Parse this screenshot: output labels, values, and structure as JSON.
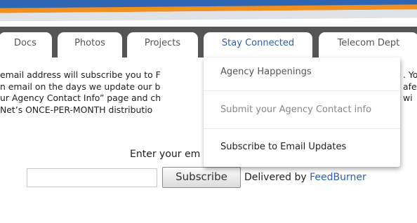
{
  "nav": {
    "tabs": [
      {
        "label": "Docs"
      },
      {
        "label": "Photos"
      },
      {
        "label": "Projects"
      },
      {
        "label": "Stay Connected"
      },
      {
        "label": "Telecom Dept"
      }
    ],
    "active_tab": "Stay Connected",
    "accent": "#2f5fa7",
    "bar_color": "#555555"
  },
  "dropdown": {
    "items": [
      {
        "label": "Agency Happenings"
      },
      {
        "label": "Submit your Agency Contact info"
      },
      {
        "label": "Subscribe to Email Updates"
      }
    ]
  },
  "content": {
    "lines": [
      "email address will subscribe you to F",
      "n email on the days we update our b",
      "ur Agency Contact Info” page and ch",
      "Net’s ONCE-PER-MONTH distributio"
    ],
    "right_fragments": [
      ". Yo",
      "afe",
      "wi",
      ""
    ],
    "enter_label": "Enter your em"
  },
  "form": {
    "email_value": "",
    "subscribe_label": "Subscribe",
    "delivered_by": "Delivered by ",
    "feedburner": "FeedBurner"
  }
}
